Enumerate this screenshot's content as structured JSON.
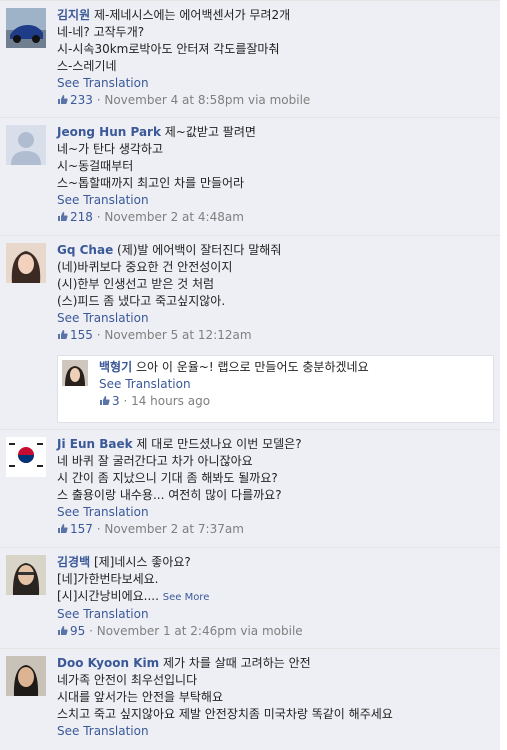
{
  "comments": [
    {
      "author": "김지원",
      "lines": [
        "제-제네시스에는 에어백센서가 무려2개",
        "네-네? 고작두개?",
        "시-시속30km로박아도 안터져 각도를잘마춰",
        "스-스레기네"
      ],
      "see_translation": "See Translation",
      "likes": "233",
      "meta": "· November 4 at 8:58pm via mobile"
    },
    {
      "author": "Jeong Hun Park",
      "lines": [
        "제~값받고 팔려면",
        "네~가 탄다 생각하고",
        "시~동걸때부터",
        "스~톱할때까지 최고인 차를 만들어라"
      ],
      "see_translation": "See Translation",
      "likes": "218",
      "meta": "· November 2 at 4:48am"
    },
    {
      "author": "Gq Chae",
      "lines": [
        "(제)발 에어백이 잘터진다 말해줘",
        "(네)바퀴보다 중요한 건 안전성이지",
        "(시)한부 인생선고 받은 것 처럼",
        "(스)피드 좀 냈다고 죽고싶지않아."
      ],
      "see_translation": "See Translation",
      "likes": "155",
      "meta": "· November 5 at 12:12am"
    },
    {
      "author": "Ji Eun Baek",
      "lines": [
        "제 대로 만드셨나요 이번 모델은?",
        "네 바퀴 잘 굴러간다고 차가 아니잖아요",
        "시 간이 좀 지났으니 기대 좀 해봐도 될까요?",
        "스 출용이랑 내수용... 여전히 많이 다를까요?"
      ],
      "see_translation": "See Translation",
      "likes": "157",
      "meta": "· November 2 at 7:37am"
    },
    {
      "author": "김경백",
      "lines": [
        "[제]네시스 좋아요?",
        "[네]가한번타보세요.",
        "[시]시간낭비에요...."
      ],
      "see_more": "See More",
      "see_translation": "See Translation",
      "likes": "95",
      "meta": "· November 1 at 2:46pm via mobile"
    },
    {
      "author": "Doo Kyoon Kim",
      "lines": [
        "제가 차를 살때 고려하는 안전",
        "네가족 안전이 최우선입니다",
        "시대를 앞서가는 안전을 부탁해요",
        "스치고 죽고 싶지않아요 제발 안전장치좀 미국차랑 똑같이 해주세요"
      ],
      "see_translation": "See Translation"
    }
  ],
  "reply": {
    "author": "백형기",
    "text": "으아 이 운율~! 랩으로 만들어도 충분하겠네요",
    "see_translation": "See Translation",
    "likes": "3",
    "meta": "· 14 hours ago"
  },
  "colors": {
    "link": "#3b5998",
    "meta": "#7f7f7f",
    "comment_bg": "#edeff4",
    "reply_bg": "#ffffff"
  },
  "icons": [
    "thumbs-up-icon"
  ]
}
